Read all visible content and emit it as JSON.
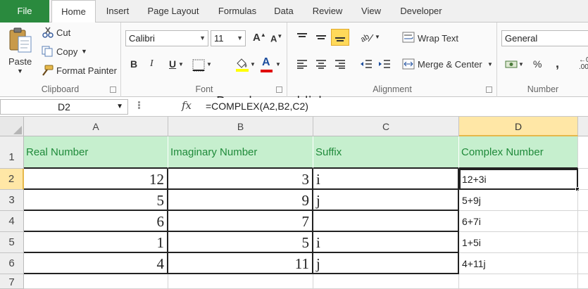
{
  "tabs": [
    "File",
    "Home",
    "Insert",
    "Page Layout",
    "Formulas",
    "Data",
    "Review",
    "View",
    "Developer"
  ],
  "ribbon": {
    "clipboard": {
      "paste": "Paste",
      "cut": "Cut",
      "copy": "Copy",
      "format_painter": "Format Painter",
      "label": "Clipboard"
    },
    "font": {
      "name": "Calibri",
      "size": "11",
      "bold": "B",
      "italic": "I",
      "underline": "U",
      "label": "Font"
    },
    "alignment": {
      "wrap_text": "Wrap Text",
      "merge_center": "Merge & Center",
      "label": "Alignment"
    },
    "number": {
      "format": "General",
      "percent": "%",
      "comma": ",",
      "label": "Number"
    }
  },
  "watermark": "Developerpublish.com",
  "formula_bar": {
    "name_box": "D2",
    "fx": "fx",
    "formula": "=COMPLEX(A2,B2,C2)"
  },
  "sheet": {
    "columns": [
      "A",
      "B",
      "C",
      "D"
    ],
    "rows": [
      "1",
      "2",
      "3",
      "4",
      "5",
      "6",
      "7"
    ],
    "active_cell": "D2",
    "headers": [
      "Real Number",
      "Imaginary Number",
      "Suffix",
      "Complex Number"
    ],
    "data": [
      [
        "12",
        "3",
        "i",
        "12+3i"
      ],
      [
        "5",
        "9",
        "j",
        "5+9j"
      ],
      [
        "6",
        "7",
        "",
        "6+7i"
      ],
      [
        "1",
        "5",
        "i",
        "1+5i"
      ],
      [
        "4",
        "11",
        "j",
        "4+11j"
      ]
    ]
  },
  "colors": {
    "file_tab": "#2a8a3e",
    "header_fill": "#c6efce",
    "header_text": "#1f8a3a",
    "selection": "#ffe7a6"
  }
}
